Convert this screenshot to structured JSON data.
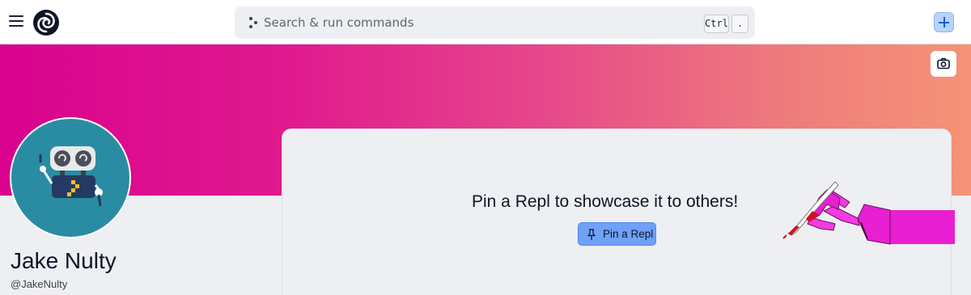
{
  "topbar": {
    "menu_icon": "hamburger-menu-icon",
    "logo_icon": "replit-logo-icon",
    "search": {
      "placeholder": "Search & run commands",
      "shortcut_keys": [
        "Ctrl",
        "."
      ]
    },
    "create_icon": "plus-icon"
  },
  "banner": {
    "gradient_colors": [
      "#d8028e",
      "#e6468b",
      "#f59377"
    ],
    "camera_icon": "camera-icon"
  },
  "profile": {
    "name": "Jake Nulty",
    "handle": "@JakeNulty",
    "avatar_bg": "#2a8ca3"
  },
  "pinned": {
    "message": "Pin a Repl to showcase it to others!",
    "button_label": "Pin a Repl",
    "button_icon": "pin-icon",
    "button_color": "#6ea2f8"
  },
  "colors": {
    "accent": "#1a5ed8",
    "text": "#0e1525",
    "hand": "#e81fd2"
  }
}
